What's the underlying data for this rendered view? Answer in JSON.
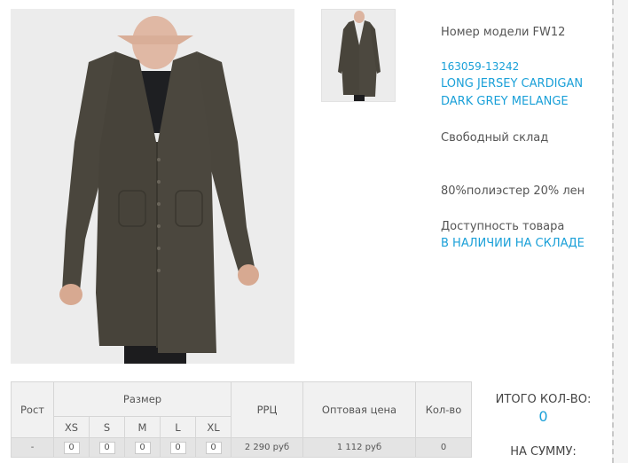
{
  "product": {
    "main_image_icon": "cardigan-photo",
    "thumbnail_icon": "cardigan-thumbnail",
    "model_label": "Номер модели FW12",
    "sku": "163059-13242",
    "name": "LONG JERSEY CARDIGAN",
    "color": "DARK GREY MELANGE",
    "warehouse": "Свободный склад",
    "composition": "80%полиэстер 20% лен",
    "availability_label": "Доступность товара",
    "availability_status": "В НАЛИЧИИ НА СКЛАДЕ"
  },
  "size_table": {
    "height_header": "Рост",
    "size_header": "Размер",
    "sizes": [
      "XS",
      "S",
      "M",
      "L",
      "XL"
    ],
    "rrp_header": "РРЦ",
    "wholesale_header": "Оптовая цена",
    "qty_header": "Кол-во",
    "row": {
      "height": "-",
      "quantities": [
        "0",
        "0",
        "0",
        "0",
        "0"
      ],
      "rrp": "2 290 руб",
      "wholesale": "1 112 руб",
      "qty": "0"
    }
  },
  "totals": {
    "count_label": "ИТОГО КОЛ-ВО:",
    "count_value": "0",
    "sum_label": "НА СУММУ:"
  },
  "colors": {
    "link": "#1aa0d8",
    "text": "#555555",
    "table_bg": "#f1f1f1",
    "garment": "#45423a"
  }
}
